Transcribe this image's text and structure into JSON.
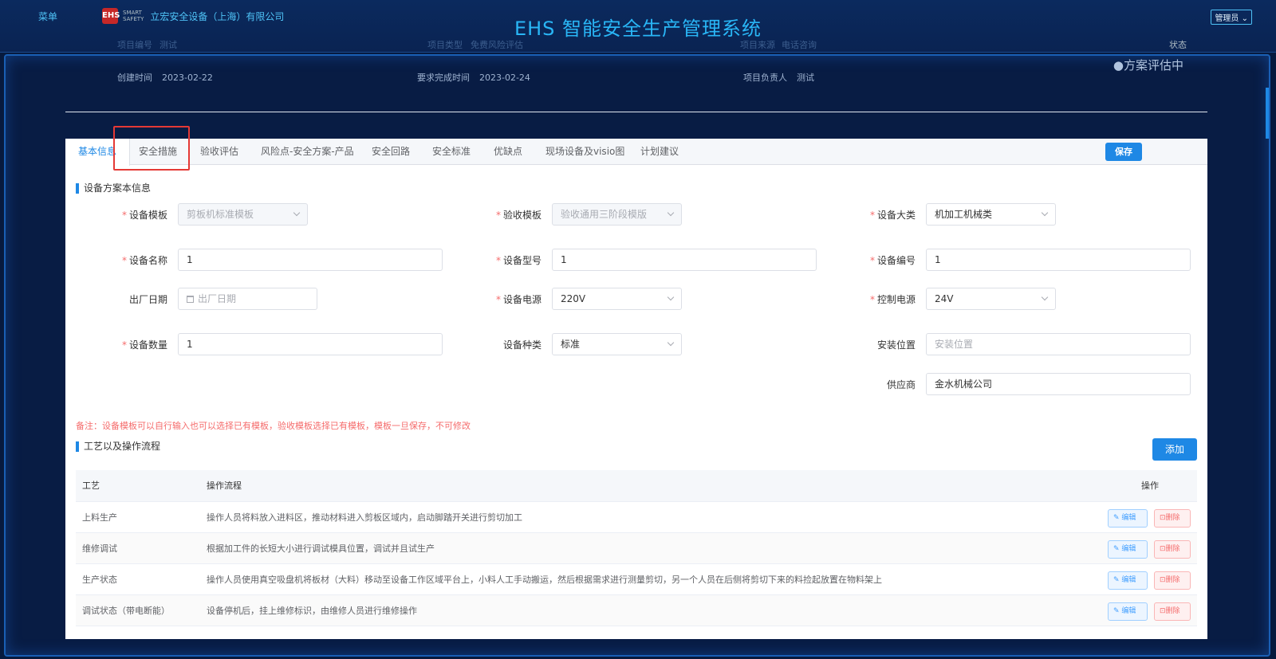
{
  "header": {
    "menu": "菜单",
    "logo_mark": "EHS",
    "logo_sub1": "SMART",
    "logo_sub2": "SAFETY",
    "company": "立宏安全设备（上海）有限公司",
    "title": "EHS 智能安全生产管理系统",
    "admin": "管理员 ⌄"
  },
  "project": {
    "number_label": "项目编号",
    "number": "测试",
    "type_label": "项目类型",
    "type": "免费风险评估",
    "source_label": "项目来源",
    "source": "电话咨询",
    "status_label": "状态",
    "created_label": "创建时间",
    "created": "2023-02-22",
    "due_label": "要求完成时间",
    "due": "2023-02-24",
    "owner_label": "项目负责人",
    "owner": "测试",
    "status": "●方案评估中"
  },
  "tabs": [
    "基本信息",
    "安全措施",
    "验收评估",
    "风险点-安全方案-产品",
    "安全回路",
    "安全标准",
    "优缺点",
    "现场设备及visio图",
    "计划建议"
  ],
  "save_label": "保存",
  "section1": "设备方案本信息",
  "form": {
    "template_label": "设备模板",
    "template": "剪板机标准模板",
    "acceptance_label": "验收模板",
    "acceptance": "验收通用三阶段模版",
    "category_label": "设备大类",
    "category": "机加工机械类",
    "name_label": "设备名称",
    "name": "1",
    "model_label": "设备型号",
    "model": "1",
    "code_label": "设备编号",
    "code": "1",
    "date_label": "出厂日期",
    "date_placeholder": "出厂日期",
    "power_label": "设备电源",
    "power": "220V",
    "control_label": "控制电源",
    "control": "24V",
    "qty_label": "设备数量",
    "qty": "1",
    "kind_label": "设备种类",
    "kind": "标准",
    "location_label": "安装位置",
    "location_placeholder": "安装位置",
    "supplier_label": "供应商",
    "supplier": "金水机械公司"
  },
  "note": "备注：设备模板可以自行输入也可以选择已有模板，验收模板选择已有模板，模板一旦保存，不可修改",
  "section2": "工艺以及操作流程",
  "add_label": "添加",
  "table": {
    "headers": [
      "工艺",
      "操作流程",
      "操作"
    ],
    "rows": [
      {
        "process": "上料生产",
        "flow": "操作人员将料放入进料区，推动材料进入剪板区域内，启动脚踏开关进行剪切加工"
      },
      {
        "process": "维修调试",
        "flow": "根据加工件的长短大小进行调试模具位置，调试并且试生产"
      },
      {
        "process": "生产状态",
        "flow": "操作人员使用真空吸盘机将板材（大料）移动至设备工作区域平台上，小料人工手动搬运，然后根据需求进行测量剪切，另一个人员在后侧将剪切下来的料捡起放置在物料架上"
      },
      {
        "process": "调试状态（带电断能）",
        "flow": "设备停机后，挂上维修标识，由维修人员进行维修操作"
      }
    ],
    "edit_label": "✎ 编辑",
    "delete_label": "⊡删除"
  }
}
